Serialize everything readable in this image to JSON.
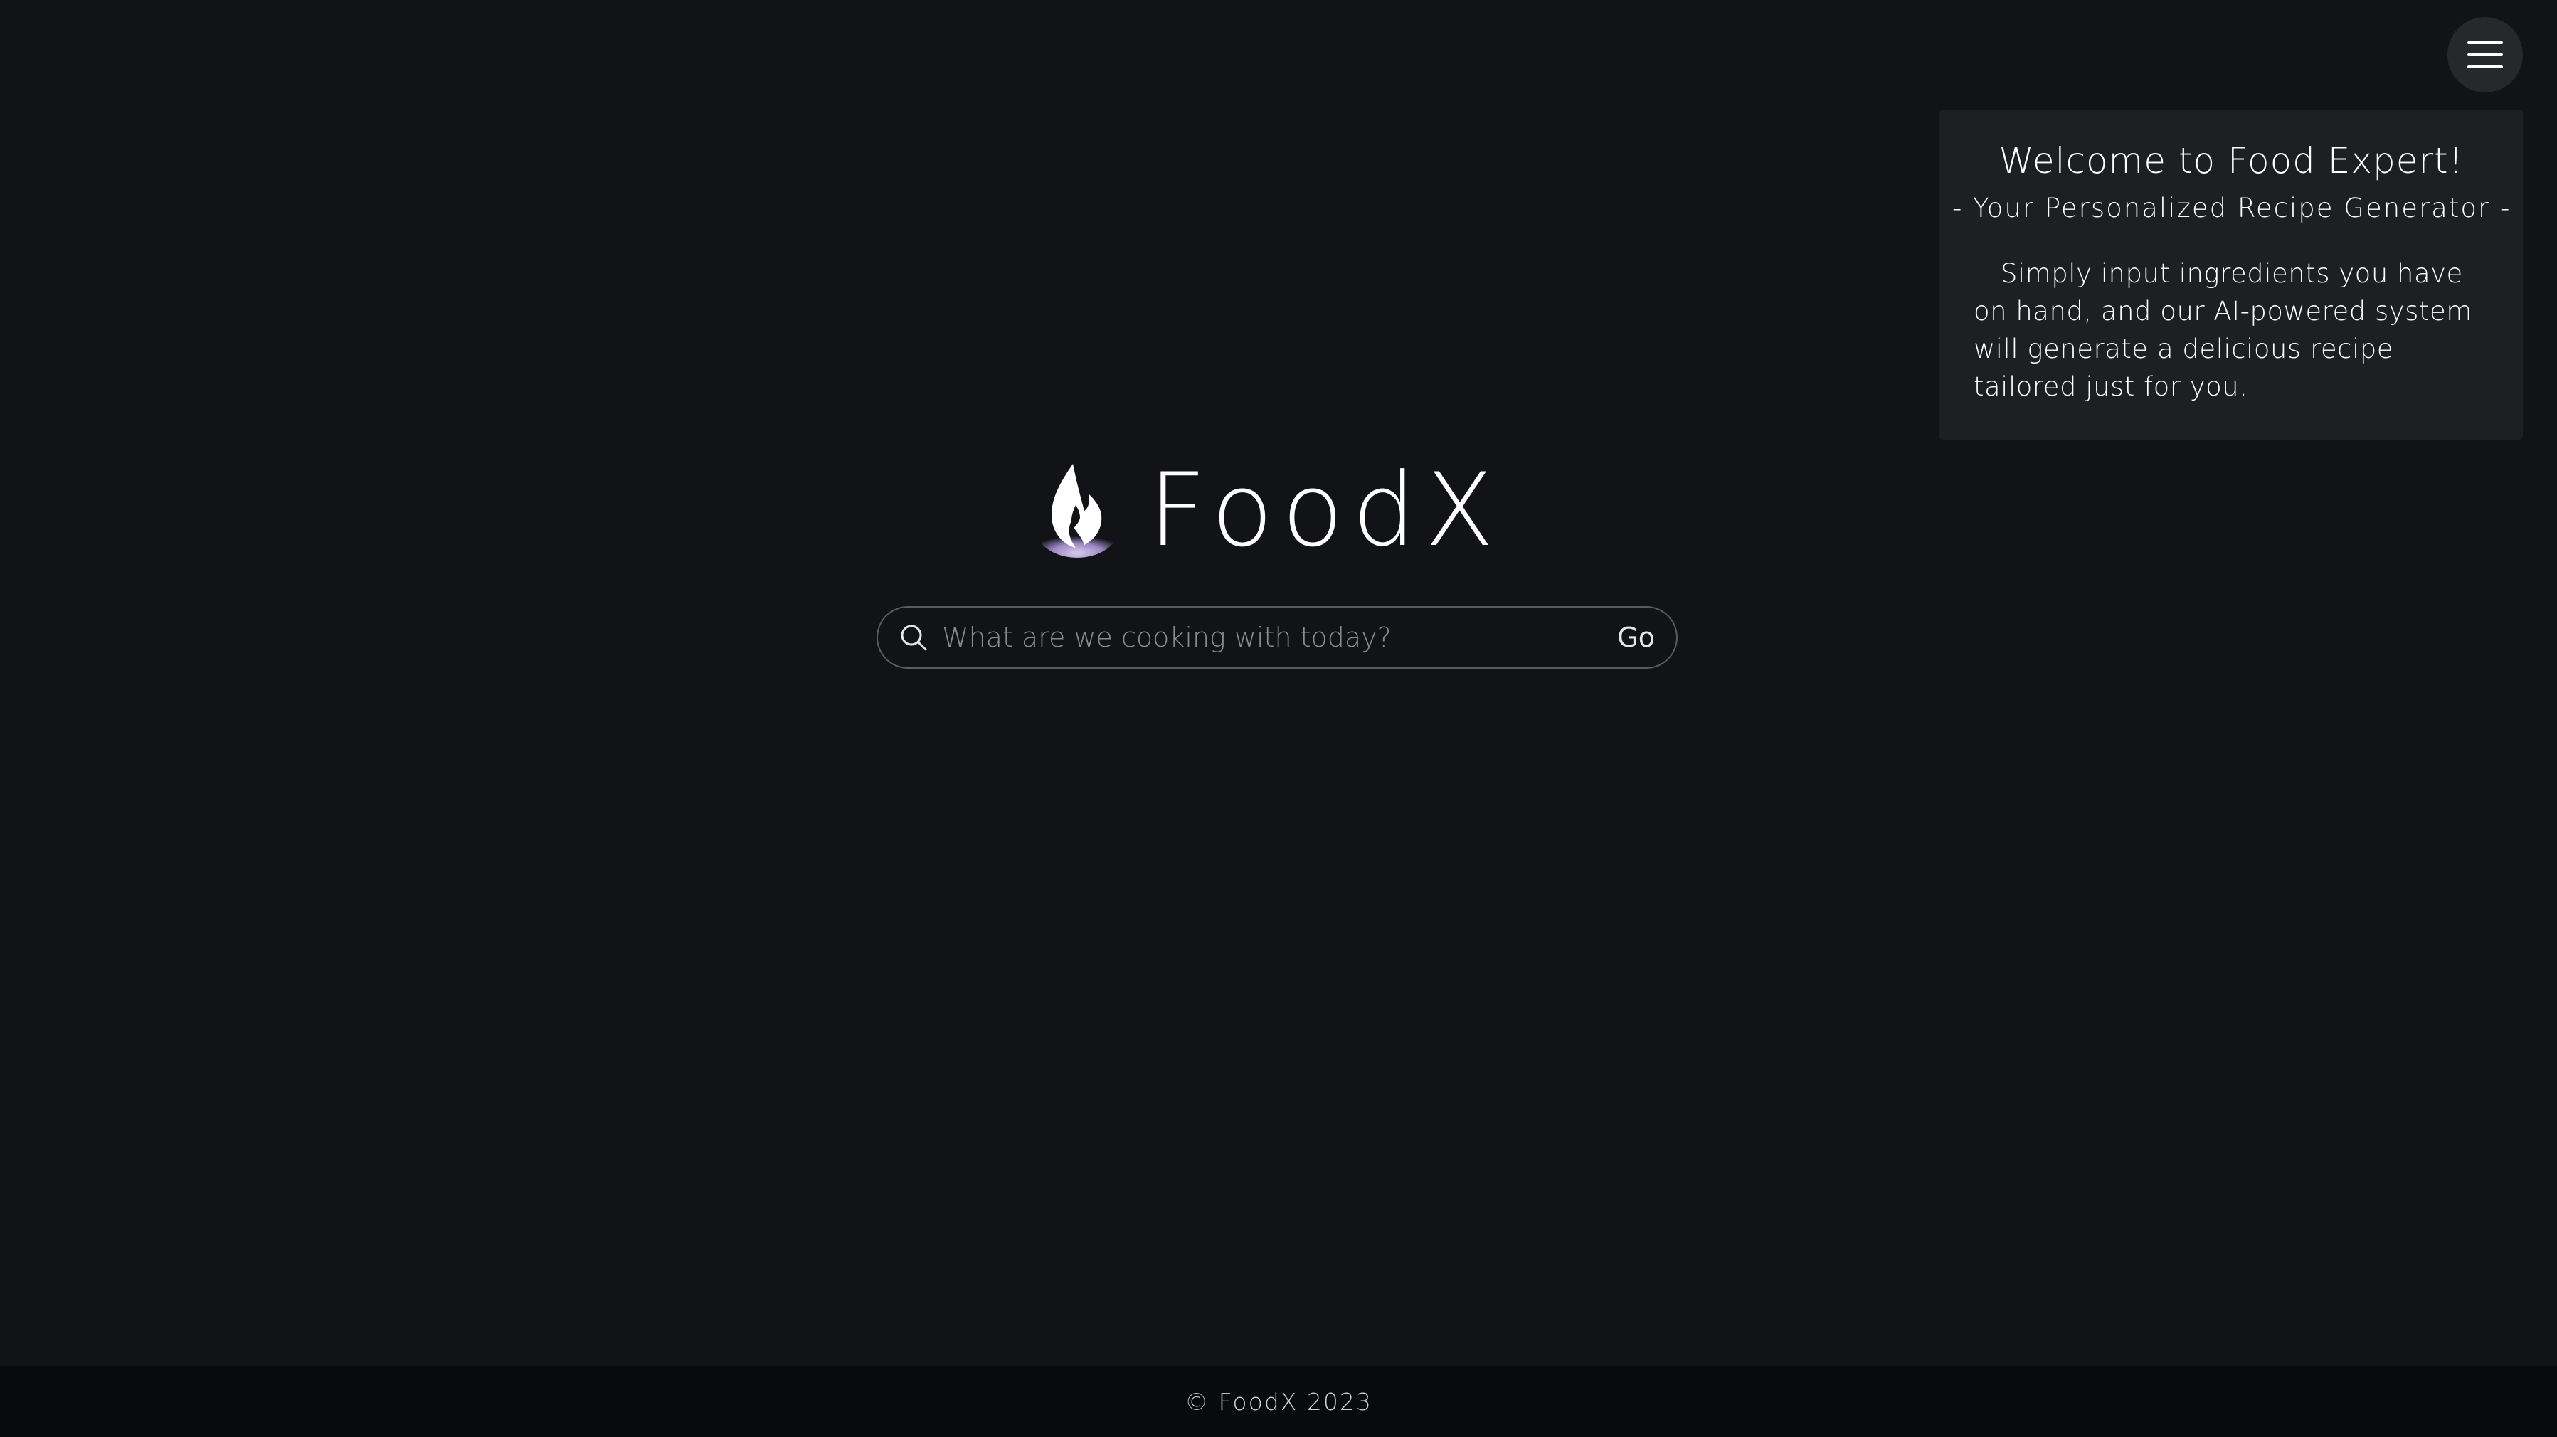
{
  "header": {
    "menu_icon": "hamburger-menu-icon"
  },
  "welcome": {
    "title": "Welcome to Food Expert!",
    "subtitle": "- Your Personalized Recipe Generator -",
    "body": "Simply input ingredients you have on hand, and our AI-powered system will generate a delicious recipe tailored just for you."
  },
  "brand": {
    "logo_icon": "flame-logo-icon",
    "name": "FoodX"
  },
  "search": {
    "icon": "search-icon",
    "value": "",
    "placeholder": "What are we cooking with today?",
    "submit_label": "Go"
  },
  "footer": {
    "copyright": "© FoodX 2023"
  },
  "colors": {
    "background": "#111317",
    "card": "#1d1f22",
    "footer": "#090a0c",
    "logo_glow": "#a996c8"
  }
}
